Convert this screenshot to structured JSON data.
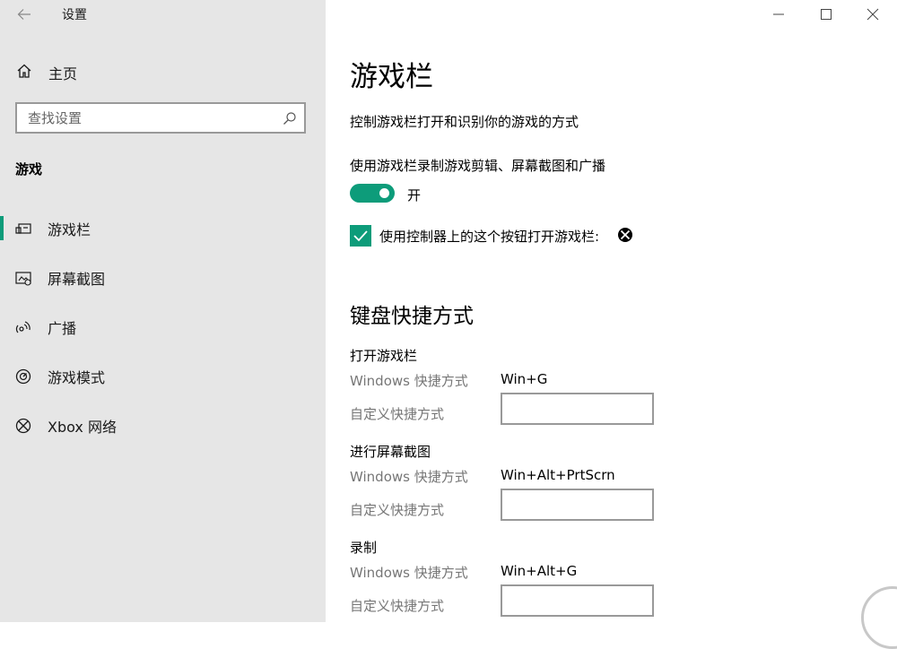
{
  "window": {
    "title": "设置",
    "controls": {
      "minimize": "minimize-icon",
      "maximize": "maximize-icon",
      "close": "close-icon"
    }
  },
  "sidebar": {
    "home_label": "主页",
    "search_placeholder": "查找设置",
    "section_label": "游戏",
    "items": [
      {
        "label": "游戏栏",
        "icon": "game-bar-icon",
        "active": true
      },
      {
        "label": "屏幕截图",
        "icon": "capture-icon",
        "active": false
      },
      {
        "label": "广播",
        "icon": "broadcast-icon",
        "active": false
      },
      {
        "label": "游戏模式",
        "icon": "game-mode-icon",
        "active": false
      },
      {
        "label": "Xbox 网络",
        "icon": "xbox-icon",
        "active": false
      }
    ]
  },
  "main": {
    "title": "游戏栏",
    "description": "控制游戏栏打开和识别你的游戏的方式",
    "record_setting": {
      "label": "使用游戏栏录制游戏剪辑、屏幕截图和广播",
      "toggle_state": "开",
      "toggle_on": true
    },
    "controller_checkbox": {
      "label": "使用控制器上的这个按钮打开游戏栏:",
      "checked": true,
      "icon": "xbox-logo-icon"
    },
    "keyboard": {
      "title": "键盘快捷方式",
      "groups": [
        {
          "title": "打开游戏栏",
          "windows_label": "Windows 快捷方式",
          "windows_value": "Win+G",
          "custom_label": "自定义快捷方式",
          "custom_value": ""
        },
        {
          "title": "进行屏幕截图",
          "windows_label": "Windows 快捷方式",
          "windows_value": "Win+Alt+PrtScrn",
          "custom_label": "自定义快捷方式",
          "custom_value": ""
        },
        {
          "title": "录制",
          "windows_label": "Windows 快捷方式",
          "windows_value": "Win+Alt+G",
          "custom_label": "自定义快捷方式",
          "custom_value": ""
        }
      ]
    }
  },
  "colors": {
    "accent": "#0d9c7a",
    "sidebar_bg": "#e6e6e6",
    "secondary_text": "#767676"
  }
}
